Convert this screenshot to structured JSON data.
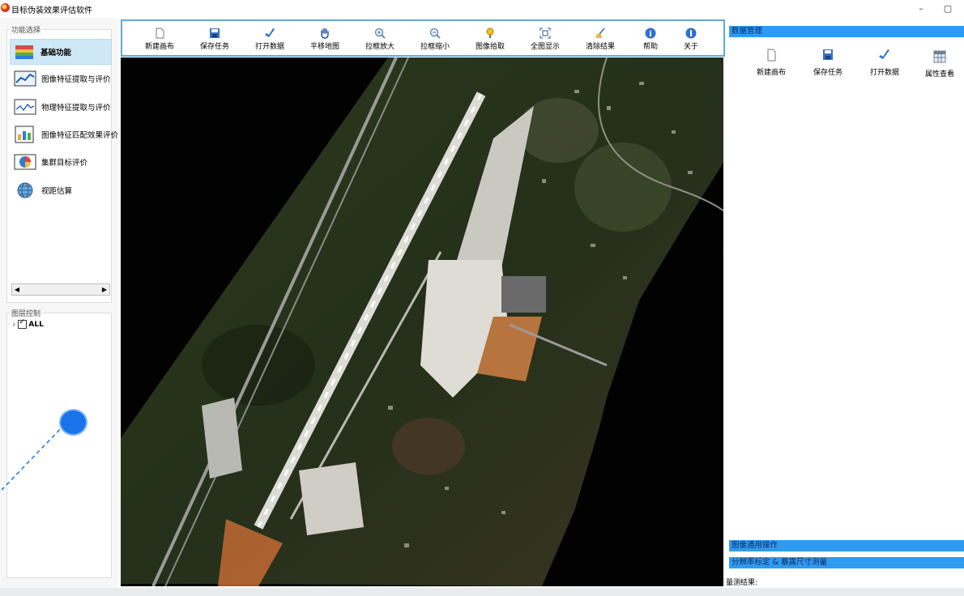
{
  "window": {
    "title": "目标伪装效果评估软件",
    "minimize_glyph": "–",
    "maximize_glyph": "▢"
  },
  "left_panel": {
    "function_group_label": "功能选择",
    "functions": [
      {
        "label": "基础功能",
        "icon": "globe-stack-icon",
        "active": true
      },
      {
        "label": "图像特征提取与评价",
        "icon": "image-chart-icon"
      },
      {
        "label": "物理特征提取与评价",
        "icon": "line-chart-icon"
      },
      {
        "label": "图像特征匹配效果评价",
        "icon": "doc-chart-icon"
      },
      {
        "label": "集群目标评价",
        "icon": "pie-chart-icon"
      },
      {
        "label": "视距估算",
        "icon": "globe-icon"
      }
    ],
    "scroll_left": "◀",
    "scroll_right": "▶",
    "layer_group_label": "图层控制",
    "layer_tree": {
      "expander": "›",
      "label": "ALL",
      "checked": true
    }
  },
  "toolbar": {
    "buttons": [
      {
        "label": "新建画布",
        "icon": "new-doc-icon"
      },
      {
        "label": "保存任务",
        "icon": "save-icon"
      },
      {
        "label": "打开数据",
        "icon": "open-data-icon"
      },
      {
        "label": "平移地图",
        "icon": "hand-pan-icon"
      },
      {
        "label": "拉框放大",
        "icon": "zoom-in-icon"
      },
      {
        "label": "拉框缩小",
        "icon": "zoom-out-icon"
      },
      {
        "label": "图像拾取",
        "icon": "pick-pin-icon"
      },
      {
        "label": "全图显示",
        "icon": "full-extent-icon"
      },
      {
        "label": "清除结果",
        "icon": "broom-icon"
      },
      {
        "label": "帮助",
        "icon": "help-icon"
      },
      {
        "label": "关于",
        "icon": "about-icon"
      }
    ]
  },
  "right_panel": {
    "data_header": "数据管理",
    "data_buttons": [
      {
        "label": "新建画布",
        "icon": "new-doc-icon"
      },
      {
        "label": "保存任务",
        "icon": "save-icon"
      },
      {
        "label": "打开数据",
        "icon": "open-data-icon"
      },
      {
        "label": "属性查看",
        "icon": "table-icon"
      }
    ],
    "general_header": "图像通用操作",
    "resolution_header": "分辨率标定 & 暴露尺寸测量",
    "measure_label": "量测结果:"
  },
  "colors": {
    "accent": "#2f9bf0",
    "toolbar_border": "#5ea9df",
    "active_item": "#cfe8f6",
    "marker": "#1a73e8"
  }
}
